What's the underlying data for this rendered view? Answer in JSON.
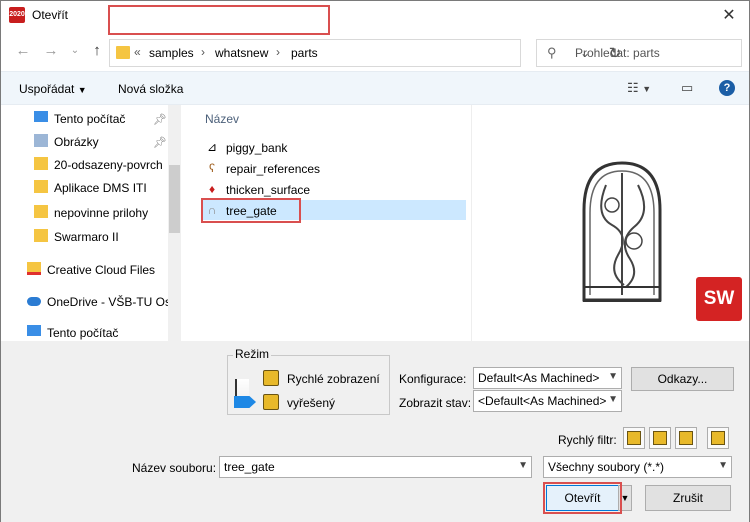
{
  "window": {
    "title": "Otevřít",
    "app_icon_text": "2020"
  },
  "nav": {
    "path": [
      "samples",
      "whatsnew",
      "parts"
    ],
    "overflow": "«",
    "search_placeholder": "Prohledat: parts"
  },
  "toolbar": {
    "organize": "Uspořádat",
    "new_folder": "Nová složka"
  },
  "sidebar": {
    "items": [
      {
        "label": "Tento počítač",
        "icon": "monitor-icon",
        "pinned": true
      },
      {
        "label": "Obrázky",
        "icon": "pictures-icon",
        "pinned": true
      },
      {
        "label": "20-odsazeny-povrch",
        "icon": "folder-icon"
      },
      {
        "label": "Aplikace DMS ITI",
        "icon": "folder-icon"
      },
      {
        "label": "nepovinne prilohy",
        "icon": "folder-icon"
      },
      {
        "label": "Swarmaro II",
        "icon": "folder-icon"
      },
      {
        "label": "Creative Cloud Files",
        "icon": "creative-cloud-icon"
      },
      {
        "label": "OneDrive - VŠB-TU Ost",
        "icon": "onedrive-icon"
      },
      {
        "label": "Tento počítač",
        "icon": "monitor-icon"
      }
    ]
  },
  "files": {
    "column_name": "Název",
    "items": [
      {
        "name": "piggy_bank",
        "icon": "drawing-icon"
      },
      {
        "name": "repair_references",
        "icon": "part-icon"
      },
      {
        "name": "thicken_surface",
        "icon": "part-icon"
      },
      {
        "name": "tree_gate",
        "icon": "part-icon",
        "selected": true
      }
    ]
  },
  "preview": {
    "logo_text": "SW"
  },
  "mode": {
    "group_label": "Režim",
    "options": [
      {
        "label": "Rychlé zobrazení",
        "icon": "quick-view-icon"
      },
      {
        "label": "vyřešený",
        "icon": "resolved-icon"
      }
    ]
  },
  "config": {
    "label": "Konfigurace:",
    "value": "Default<As Machined>",
    "refs_button": "Odkazy...",
    "display_label": "Zobrazit stav:",
    "display_value": "<Default<As Machined>"
  },
  "quick_filter": {
    "label": "Rychlý filtr:"
  },
  "filename": {
    "label": "Název souboru:",
    "value": "tree_gate",
    "type_value": "Všechny soubory (*.*)"
  },
  "buttons": {
    "open": "Otevřít",
    "cancel": "Zrušit"
  },
  "colors": {
    "accent": "#0078d7",
    "highlight": "#d94f4f",
    "selection": "#cce8ff"
  }
}
